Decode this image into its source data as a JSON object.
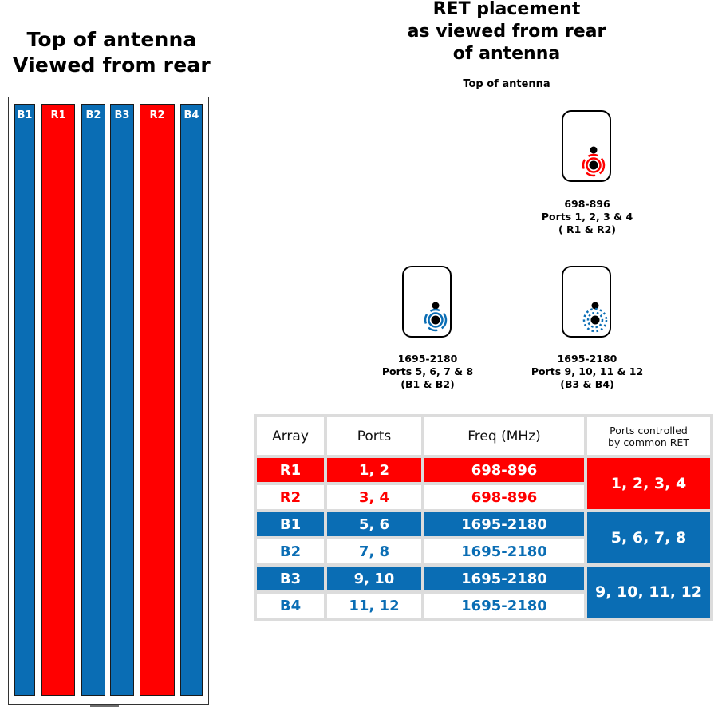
{
  "left_panel": {
    "title_line1": "Top of antenna",
    "title_line2": "Viewed from rear",
    "arrays": [
      {
        "label": "B1",
        "color": "blue"
      },
      {
        "label": "R1",
        "color": "red"
      },
      {
        "label": "B2",
        "color": "blue"
      },
      {
        "label": "B3",
        "color": "blue"
      },
      {
        "label": "R2",
        "color": "red"
      },
      {
        "label": "B4",
        "color": "blue"
      }
    ]
  },
  "right_panel": {
    "title_line1": "RET placement",
    "title_line2": "as viewed from rear",
    "title_line3": "of antenna",
    "top_label": "Top of antenna",
    "rets": [
      {
        "freq": "698-896",
        "ports": "Ports 1, 2, 3 & 4",
        "arrays": "( R1 & R2)",
        "icon": "ret-actuator-red-icon",
        "color": "#ff0000"
      },
      {
        "freq": "1695-2180",
        "ports": "Ports 5, 6, 7 & 8",
        "arrays": "(B1 & B2)",
        "icon": "ret-actuator-blue-icon",
        "color": "#0a6db4"
      },
      {
        "freq": "1695-2180",
        "ports": "Ports 9, 10, 11 & 12",
        "arrays": "(B3 & B4)",
        "icon": "ret-actuator-blue-dotted-icon",
        "color": "#0a6db4"
      }
    ]
  },
  "table": {
    "headers": [
      "Array",
      "Ports",
      "Freq (MHz)",
      "Ports controlled by common RET"
    ],
    "header_ret_line1": "Ports controlled",
    "header_ret_line2": "by common RET",
    "rows": [
      {
        "array": "R1",
        "ports": "1, 2",
        "freq": "698-896"
      },
      {
        "array": "R2",
        "ports": "3, 4",
        "freq": "698-896"
      },
      {
        "array": "B1",
        "ports": "5, 6",
        "freq": "1695-2180"
      },
      {
        "array": "B2",
        "ports": "7, 8",
        "freq": "1695-2180"
      },
      {
        "array": "B3",
        "ports": "9, 10",
        "freq": "1695-2180"
      },
      {
        "array": "B4",
        "ports": "11, 12",
        "freq": "1695-2180"
      }
    ],
    "ret_groups": [
      "1, 2, 3, 4",
      "5, 6, 7, 8",
      "9, 10, 11, 12"
    ]
  },
  "colors": {
    "red": "#ff0000",
    "blue": "#0a6db4",
    "grid": "#dcdcdc"
  }
}
